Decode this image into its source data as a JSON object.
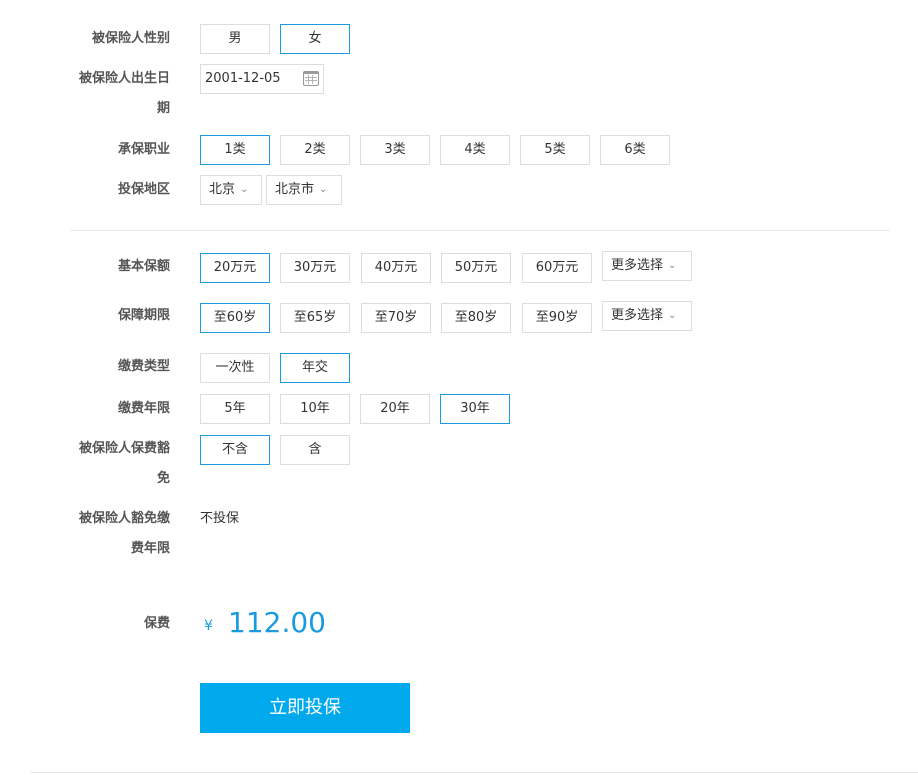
{
  "gender": {
    "label": "被保险人性别",
    "options": [
      "男",
      "女"
    ],
    "selected": "女"
  },
  "birthdate": {
    "label_line1": "被保险人出生日",
    "label_line2": "期",
    "value": "2001-12-05"
  },
  "occupation": {
    "label": "承保职业",
    "options": [
      "1类",
      "2类",
      "3类",
      "4类",
      "5类",
      "6类"
    ],
    "selected": "1类"
  },
  "region": {
    "label": "投保地区",
    "province": "北京",
    "city": "北京市"
  },
  "coverage": {
    "label": "基本保额",
    "options": [
      "20万元",
      "30万元",
      "40万元",
      "50万元",
      "60万元"
    ],
    "selected": "20万元",
    "more": "更多选择"
  },
  "period": {
    "label": "保障期限",
    "options": [
      "至60岁",
      "至65岁",
      "至70岁",
      "至80岁",
      "至90岁"
    ],
    "selected": "至60岁",
    "more": "更多选择"
  },
  "payment_type": {
    "label": "缴费类型",
    "options": [
      "一次性",
      "年交"
    ],
    "selected": "年交"
  },
  "payment_years": {
    "label": "缴费年限",
    "options": [
      "5年",
      "10年",
      "20年",
      "30年"
    ],
    "selected": "30年"
  },
  "waiver": {
    "label_line1": "被保险人保费豁",
    "label_line2": "免",
    "options": [
      "不含",
      "含"
    ],
    "selected": "不含"
  },
  "waiver_period": {
    "label_line1": "被保险人豁免缴",
    "label_line2": "费年限",
    "value": "不投保"
  },
  "premium": {
    "label": "保费",
    "currency": "¥",
    "amount": "112.00"
  },
  "submit_label": "立即投保",
  "icons": {
    "calendar": "calendar-icon",
    "chevron": "chevron-down-icon"
  },
  "colors": {
    "accent": "#1a9be0",
    "button": "#00a9ec",
    "border": "#dddddd"
  }
}
